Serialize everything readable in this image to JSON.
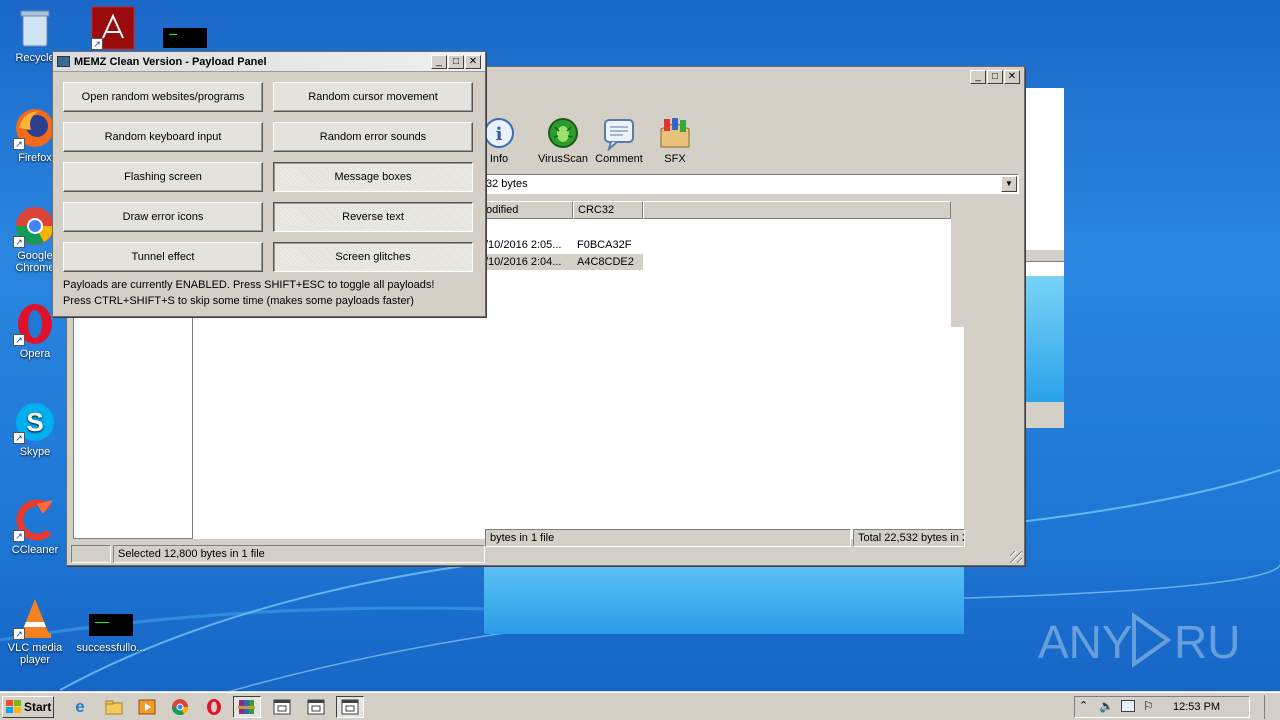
{
  "desktop": {
    "icons": [
      {
        "label": "Recycle",
        "icon": "recycle-bin-icon"
      },
      {
        "label": "",
        "icon": "acrobat-icon"
      },
      {
        "label": "",
        "icon": "console-icon"
      },
      {
        "label": "Firefox",
        "icon": "firefox-icon"
      },
      {
        "label": "Google Chrome",
        "icon": "chrome-icon"
      },
      {
        "label": "Opera",
        "icon": "opera-icon"
      },
      {
        "label": "Skype",
        "icon": "skype-icon"
      },
      {
        "label": "CCleaner",
        "icon": "ccleaner-icon"
      },
      {
        "label": "VLC media player",
        "icon": "vlc-icon"
      },
      {
        "label": "successfullo...",
        "icon": "console-icon"
      }
    ],
    "watermark": "ANY RUN"
  },
  "memz": {
    "title": "MEMZ Clean Version - Payload Panel",
    "buttons": [
      {
        "label": "Open random websites/programs",
        "checked": false
      },
      {
        "label": "Random cursor movement",
        "checked": false
      },
      {
        "label": "Random keyboard input",
        "checked": false
      },
      {
        "label": "Random error sounds",
        "checked": false
      },
      {
        "label": "Flashing screen",
        "checked": false
      },
      {
        "label": "Message boxes",
        "checked": true
      },
      {
        "label": "Draw error icons",
        "checked": false
      },
      {
        "label": "Reverse text",
        "checked": true
      },
      {
        "label": "Tunnel effect",
        "checked": false
      },
      {
        "label": "Screen glitches",
        "checked": true
      }
    ],
    "info_line1": "Payloads are currently ENABLED. Press SHIFT+ESC to toggle all payloads!",
    "info_line2": "Press CTRL+SHIFT+S to skip some time (makes some payloads faster)"
  },
  "winrar": {
    "toolbar": [
      {
        "label": "Info",
        "icon": "info-icon"
      },
      {
        "label": "VirusScan",
        "icon": "virus-scan-icon"
      },
      {
        "label": "Comment",
        "icon": "comment-icon"
      },
      {
        "label": "SFX",
        "icon": "sfx-icon"
      }
    ],
    "address_value": "32 bytes",
    "columns": [
      "odified",
      "CRC32"
    ],
    "rows": [
      {
        "modified": "/10/2016 2:05...",
        "crc": "F0BCA32F",
        "selected": false
      },
      {
        "modified": "/10/2016 2:04...",
        "crc": "A4C8CDE2",
        "selected": true
      }
    ],
    "status_left": "Selected 12,800 bytes in 1 file",
    "status_mid": "bytes in 1 file",
    "status_right": "Total 22,532 bytes in 2"
  },
  "taskbar": {
    "start_label": "Start",
    "clock": "12:53 PM"
  },
  "colors": {
    "desktop_blue": "#1f78d6",
    "window_face": "#d4d0c8",
    "selected_row": "#d4d0c8"
  }
}
